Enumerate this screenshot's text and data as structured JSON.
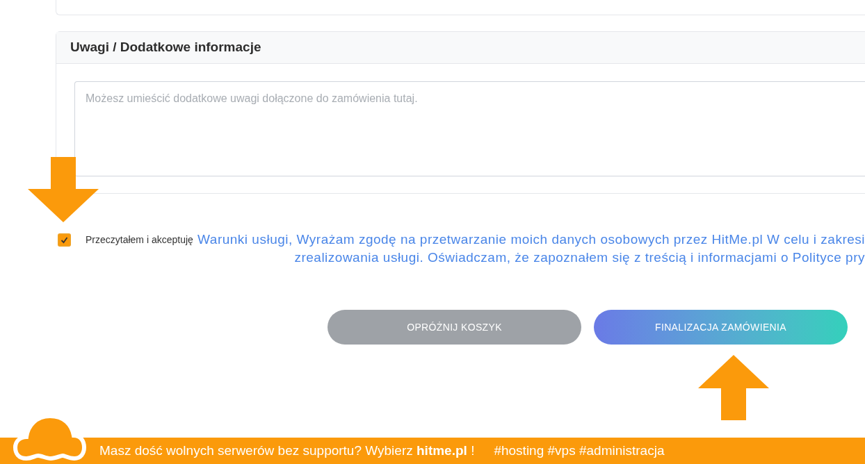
{
  "notes_section": {
    "title": "Uwagi / Dodatkowe informacje",
    "placeholder": "Możesz umieścić dodatkowe uwagi dołączone do zamówienia tutaj."
  },
  "agreement": {
    "checked": true,
    "label": "Przeczytałem i akceptuję",
    "link": "Warunki usługi",
    "lines": [
      ", Wyrażam zgodę na przetwarzanie moich danych osobowych przez HitMe.pl W celu i zakresi",
      "zrealizowania usługi. Oświadczam, że zapoznałem się z treścią i informacjami o Polityce pry"
    ]
  },
  "buttons": [
    {
      "label": "OPRÓŻNIJ KOSZYK",
      "kind": "secondary"
    },
    {
      "label": "FINALIZACJA ZAMÓWIENIA",
      "kind": "primary"
    }
  ],
  "banner": {
    "text": "Masz dość wolnych serwerów bez supportu? Wybierz **hitme.pl** !",
    "tags": "#hosting #vps #administracja"
  }
}
